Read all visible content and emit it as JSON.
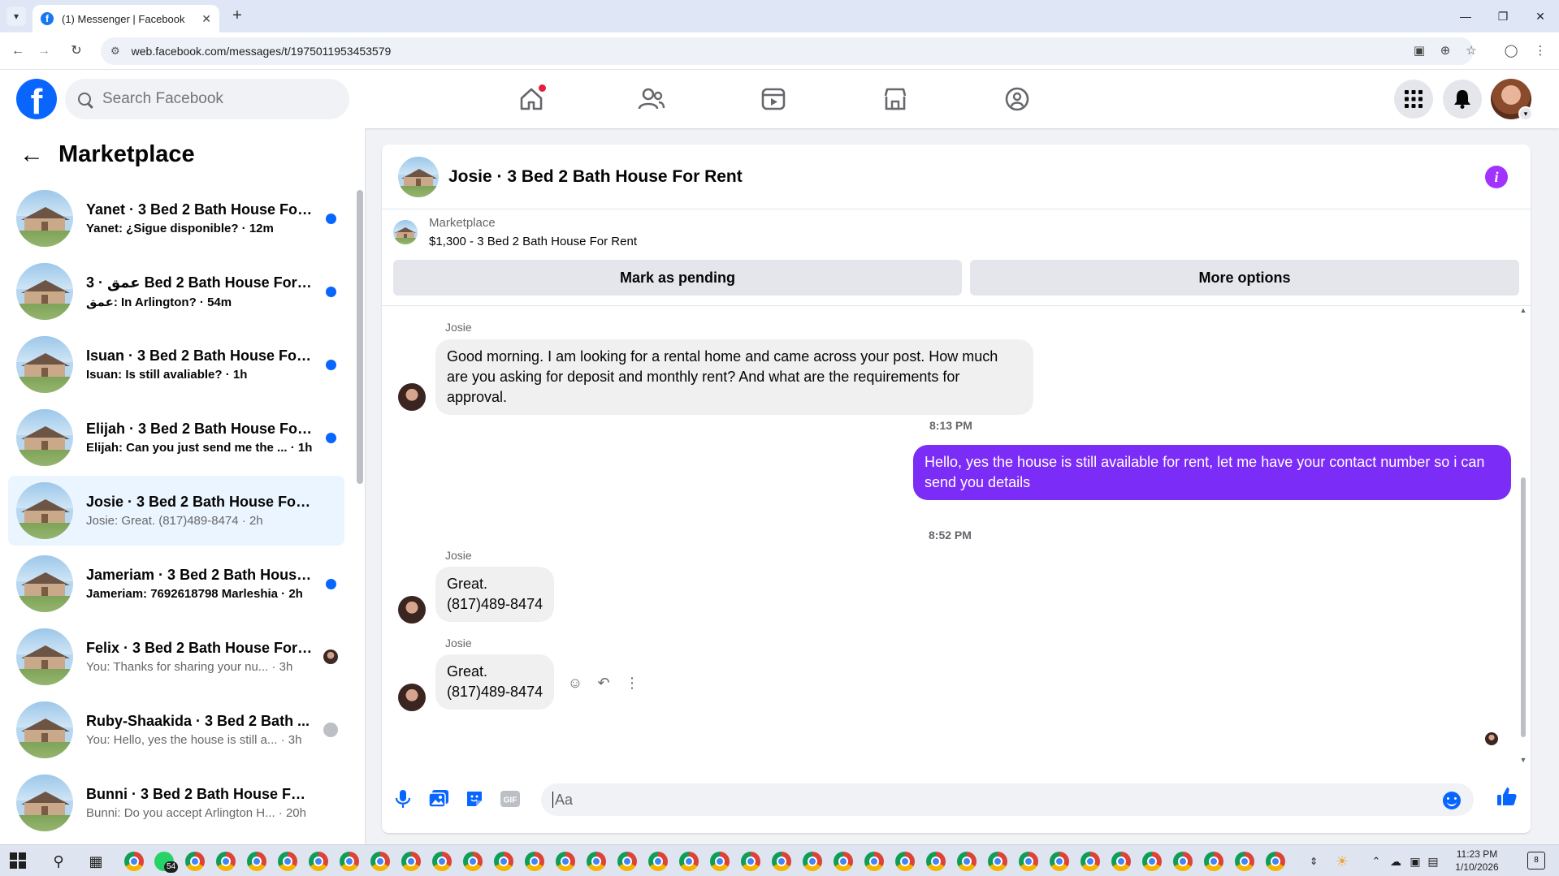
{
  "browser": {
    "tab_title": "(1) Messenger | Facebook",
    "url": "web.facebook.com/messages/t/1975011953453579"
  },
  "header": {
    "search_placeholder": "Search Facebook",
    "logo_letter": "f"
  },
  "sidebar": {
    "title": "Marketplace",
    "conversations": [
      {
        "name": "Yanet · 3 Bed 2 Bath House For...",
        "preview": "Yanet: ¿Sigue disponible? · 12m",
        "state": "unread"
      },
      {
        "name": "عمق · 3 Bed 2 Bath House For Rent ...",
        "preview": "عمق: In Arlington? · 54m",
        "state": "unread"
      },
      {
        "name": "Isuan · 3 Bed 2 Bath House For ...",
        "preview": "Isuan: Is still avaliable? · 1h",
        "state": "unread"
      },
      {
        "name": "Elijah · 3 Bed 2 Bath House For ...",
        "preview": "Elijah: Can you just send me the ... · 1h",
        "state": "unread"
      },
      {
        "name": "Josie · 3 Bed 2 Bath House For R...",
        "preview": "Josie: Great. (817)489-8474 · 2h",
        "state": "active"
      },
      {
        "name": "Jameriam · 3 Bed 2 Bath House...",
        "preview": "Jameriam: 7692618798 Marleshia · 2h",
        "state": "unread"
      },
      {
        "name": "Felix · 3 Bed 2 Bath House For ...",
        "preview": "You: Thanks for sharing your nu... · 3h",
        "state": "seen"
      },
      {
        "name": "Ruby-Shaakida · 3 Bed 2 Bath ...",
        "preview": "You: Hello, yes the house is still a... · 3h",
        "state": "seen-grey"
      },
      {
        "name": "Bunni · 3 Bed 2 Bath House For R...",
        "preview": "Bunni: Do you accept Arlington H... · 20h",
        "state": "read"
      }
    ]
  },
  "chat": {
    "title": "Josie · 3 Bed 2 Bath House For Rent",
    "listing_source": "Marketplace",
    "listing_price": "$1,300 - 3 Bed 2 Bath House For Rent",
    "mark_pending_label": "Mark as pending",
    "more_options_label": "More options",
    "messages": {
      "m1_sender": "Josie",
      "m1_text": "Good morning. I am looking for a rental home and came across your post. How much are you asking for deposit and monthly rent? And what are the requirements for approval.",
      "ts1": "8:13 PM",
      "m2_text": "Hello, yes the house is still available for rent, let me have your contact number so i can send you  details",
      "ts2": "8:52 PM",
      "m3_sender": "Josie",
      "m3_line1": "Great.",
      "m3_line2": "(817)489-8474",
      "m4_sender": "Josie",
      "m4_line1": "Great.",
      "m4_line2": "(817)489-8474"
    },
    "composer_placeholder": "Aa"
  },
  "taskbar": {
    "whatsapp_badge": "54",
    "clock_time": "11:23 PM",
    "clock_date": "1/10/2026",
    "notification_count": "8"
  },
  "colors": {
    "fb_blue": "#0866ff",
    "outgoing_bubble": "#7c2cf7",
    "info_purple": "#a033ff",
    "unread_dot": "#0866ff"
  }
}
